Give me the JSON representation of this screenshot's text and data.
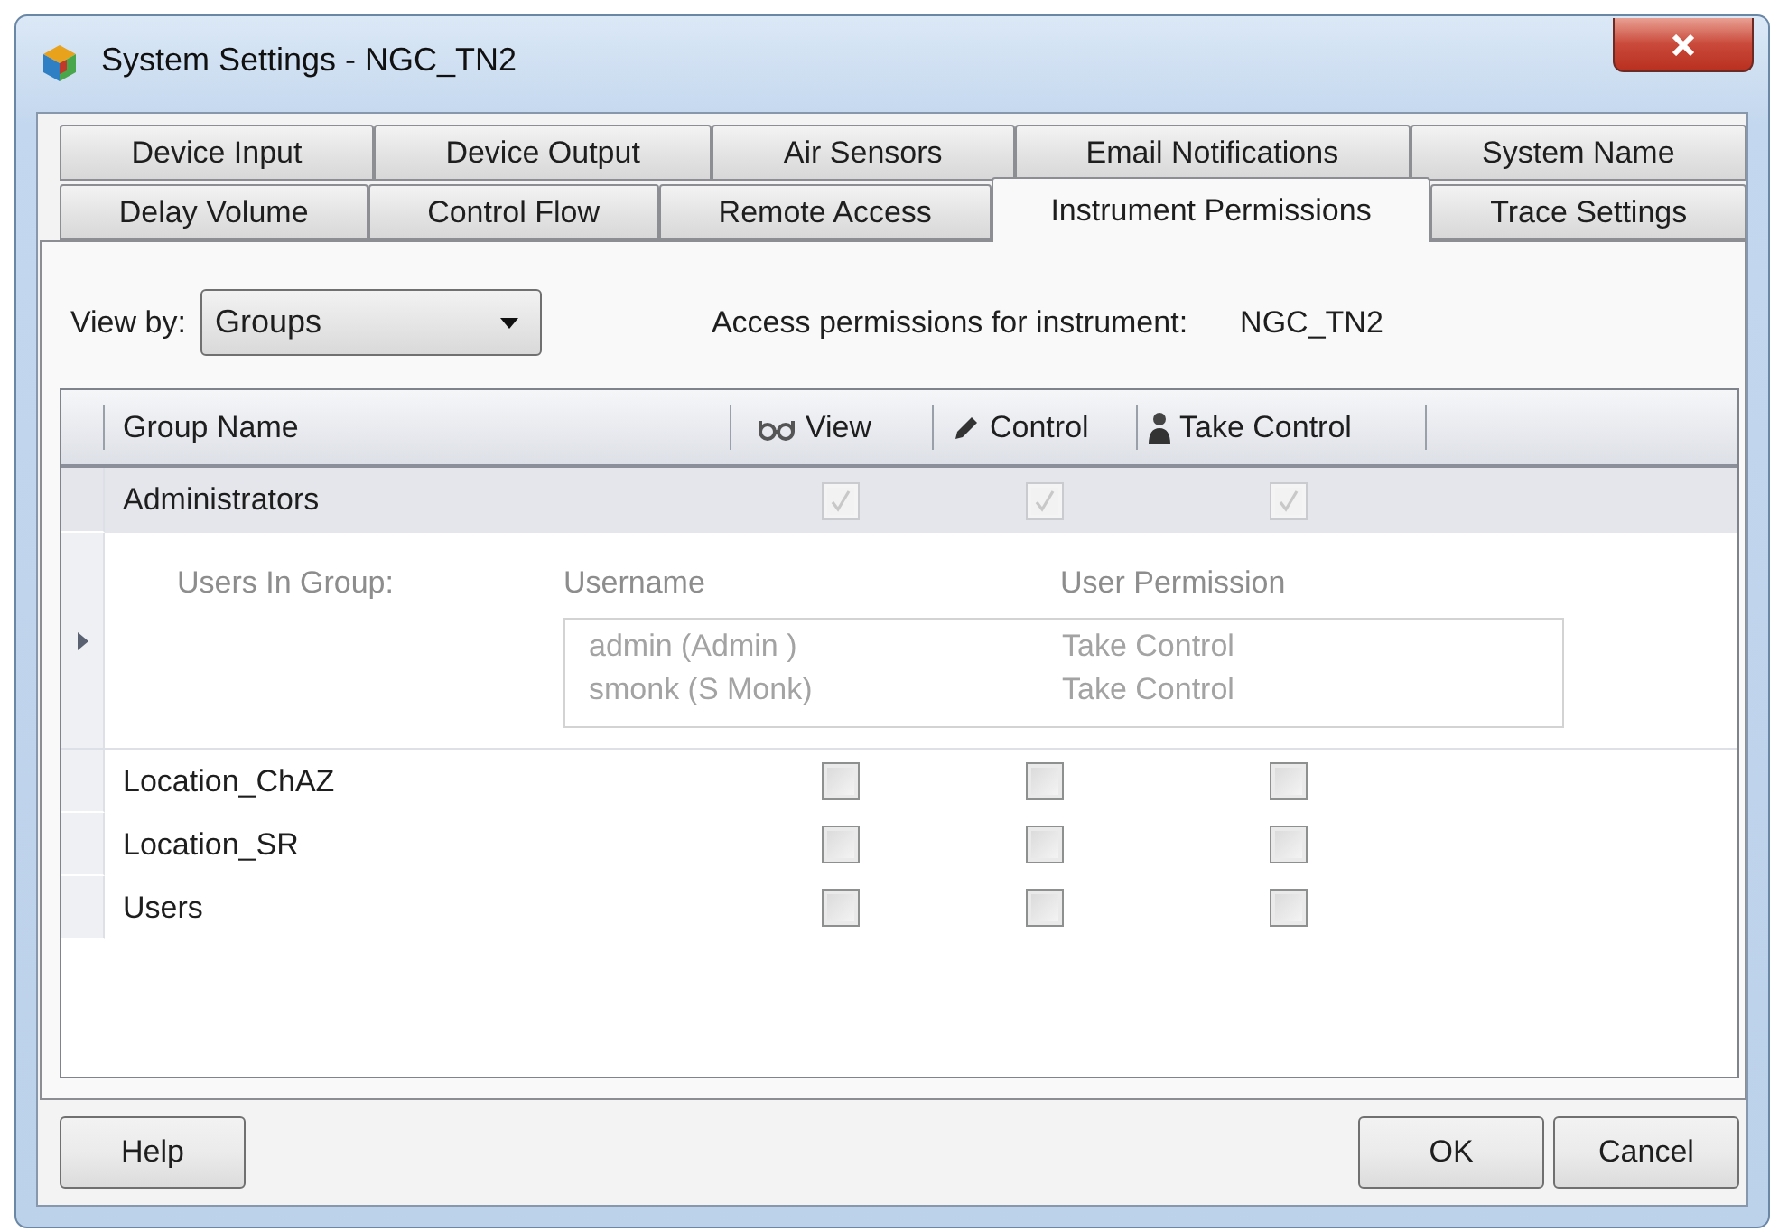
{
  "window": {
    "title": "System Settings - NGC_TN2"
  },
  "tab_rows": [
    [
      {
        "label": "Device Input",
        "selected": false
      },
      {
        "label": "Device Output",
        "selected": false
      },
      {
        "label": "Air Sensors",
        "selected": false
      },
      {
        "label": "Email Notifications",
        "selected": false
      },
      {
        "label": "System Name",
        "selected": false
      }
    ],
    [
      {
        "label": "Delay Volume",
        "selected": false
      },
      {
        "label": "Control Flow",
        "selected": false
      },
      {
        "label": "Remote Access",
        "selected": false
      },
      {
        "label": "Instrument Permissions",
        "selected": true
      },
      {
        "label": "Trace Settings",
        "selected": false
      }
    ]
  ],
  "view_by": {
    "label": "View by:",
    "value": "Groups"
  },
  "access": {
    "label": "Access permissions for instrument:",
    "value": "NGC_TN2"
  },
  "columns": [
    "Group Name",
    "View",
    "Control",
    "Take Control"
  ],
  "rows": [
    {
      "name": "Administrators",
      "selected": true,
      "expanded": true,
      "permissions": [
        {
          "checked": true,
          "disabled": true
        },
        {
          "checked": true,
          "disabled": true
        },
        {
          "checked": true,
          "disabled": true
        }
      ],
      "details": {
        "label": "Users In Group:",
        "columns": [
          "Username",
          "User Permission"
        ],
        "users": [
          {
            "username": "admin (Admin )",
            "permission": "Take Control"
          },
          {
            "username": "smonk (S Monk)",
            "permission": "Take Control"
          }
        ]
      }
    },
    {
      "name": "Location_ChAZ",
      "selected": false,
      "permissions": [
        {
          "checked": false,
          "disabled": false
        },
        {
          "checked": false,
          "disabled": false
        },
        {
          "checked": false,
          "disabled": false
        }
      ]
    },
    {
      "name": "Location_SR",
      "selected": false,
      "permissions": [
        {
          "checked": false,
          "disabled": false
        },
        {
          "checked": false,
          "disabled": false
        },
        {
          "checked": false,
          "disabled": false
        }
      ]
    },
    {
      "name": "Users",
      "selected": false,
      "permissions": [
        {
          "checked": false,
          "disabled": false
        },
        {
          "checked": false,
          "disabled": false
        },
        {
          "checked": false,
          "disabled": false
        }
      ]
    }
  ],
  "footer": {
    "left_buttons": [
      "Help"
    ],
    "right_buttons": [
      "OK",
      "Cancel"
    ]
  }
}
